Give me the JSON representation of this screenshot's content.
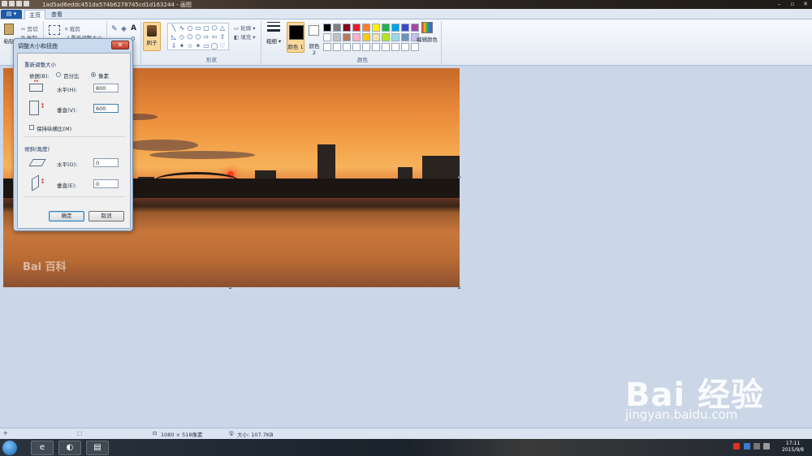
{
  "window": {
    "title": "1ad5ad6eddc451da574b6278745cd1d163244 - 画图"
  },
  "ribbon": {
    "tabs": [
      {
        "label": "主页",
        "active": true
      },
      {
        "label": "查看",
        "active": false
      }
    ],
    "clipboard": {
      "paste": "粘贴",
      "cut": "剪切",
      "copy": "复制"
    },
    "image": {
      "crop": "裁剪",
      "resize": "重新调整大小"
    },
    "brushes_label": "刷子",
    "shapes": {
      "group_label": "形状",
      "outline": "轮廓",
      "fill": "填充"
    },
    "size_label": "粗细",
    "color1_label": "颜色 1",
    "color2_label": "颜色 2",
    "edit_colors_label": "编辑颜色",
    "colors_group_label": "颜色",
    "palette": [
      "#000000",
      "#7f7f7f",
      "#880015",
      "#ed1c24",
      "#ff7f27",
      "#fff200",
      "#22b14c",
      "#00a2e8",
      "#3f48cc",
      "#a349a4",
      "#ffffff",
      "#c3c3c3",
      "#b97a57",
      "#ffaec9",
      "#ffc90e",
      "#efe4b0",
      "#b5e61d",
      "#99d9ea",
      "#7092be",
      "#c8bfe7",
      "#ffffff",
      "#ffffff",
      "#ffffff",
      "#ffffff",
      "#ffffff",
      "#ffffff",
      "#ffffff",
      "#ffffff",
      "#ffffff",
      "#ffffff"
    ]
  },
  "dialog": {
    "title": "调整大小和扭曲",
    "resize_section": "重新调整大小",
    "by_label": "依据(B):",
    "percent_label": "百分比",
    "pixels_label": "像素",
    "selected": "pixels",
    "horizontal_label": "水平(H):",
    "horizontal_value": "800",
    "vertical_label": "垂直(V):",
    "vertical_value": "600",
    "keep_ratio_label": "保持纵横比(M)",
    "keep_ratio_checked": false,
    "skew_section": "倾斜(角度)",
    "skew_h_label": "水平(O):",
    "skew_h_value": "0",
    "skew_v_label": "垂直(E):",
    "skew_v_value": "0",
    "ok_label": "确定",
    "cancel_label": "取消"
  },
  "canvas": {
    "watermark": "Bai 百科"
  },
  "statusbar": {
    "dimensions": "1080 × 518像素",
    "size": "大小: 107.7KB"
  },
  "taskbar": {
    "time": "17:11",
    "date": "2015/9/8"
  },
  "watermark": {
    "brand": "Bai 经验",
    "url": "jingyan.baidu.com"
  }
}
